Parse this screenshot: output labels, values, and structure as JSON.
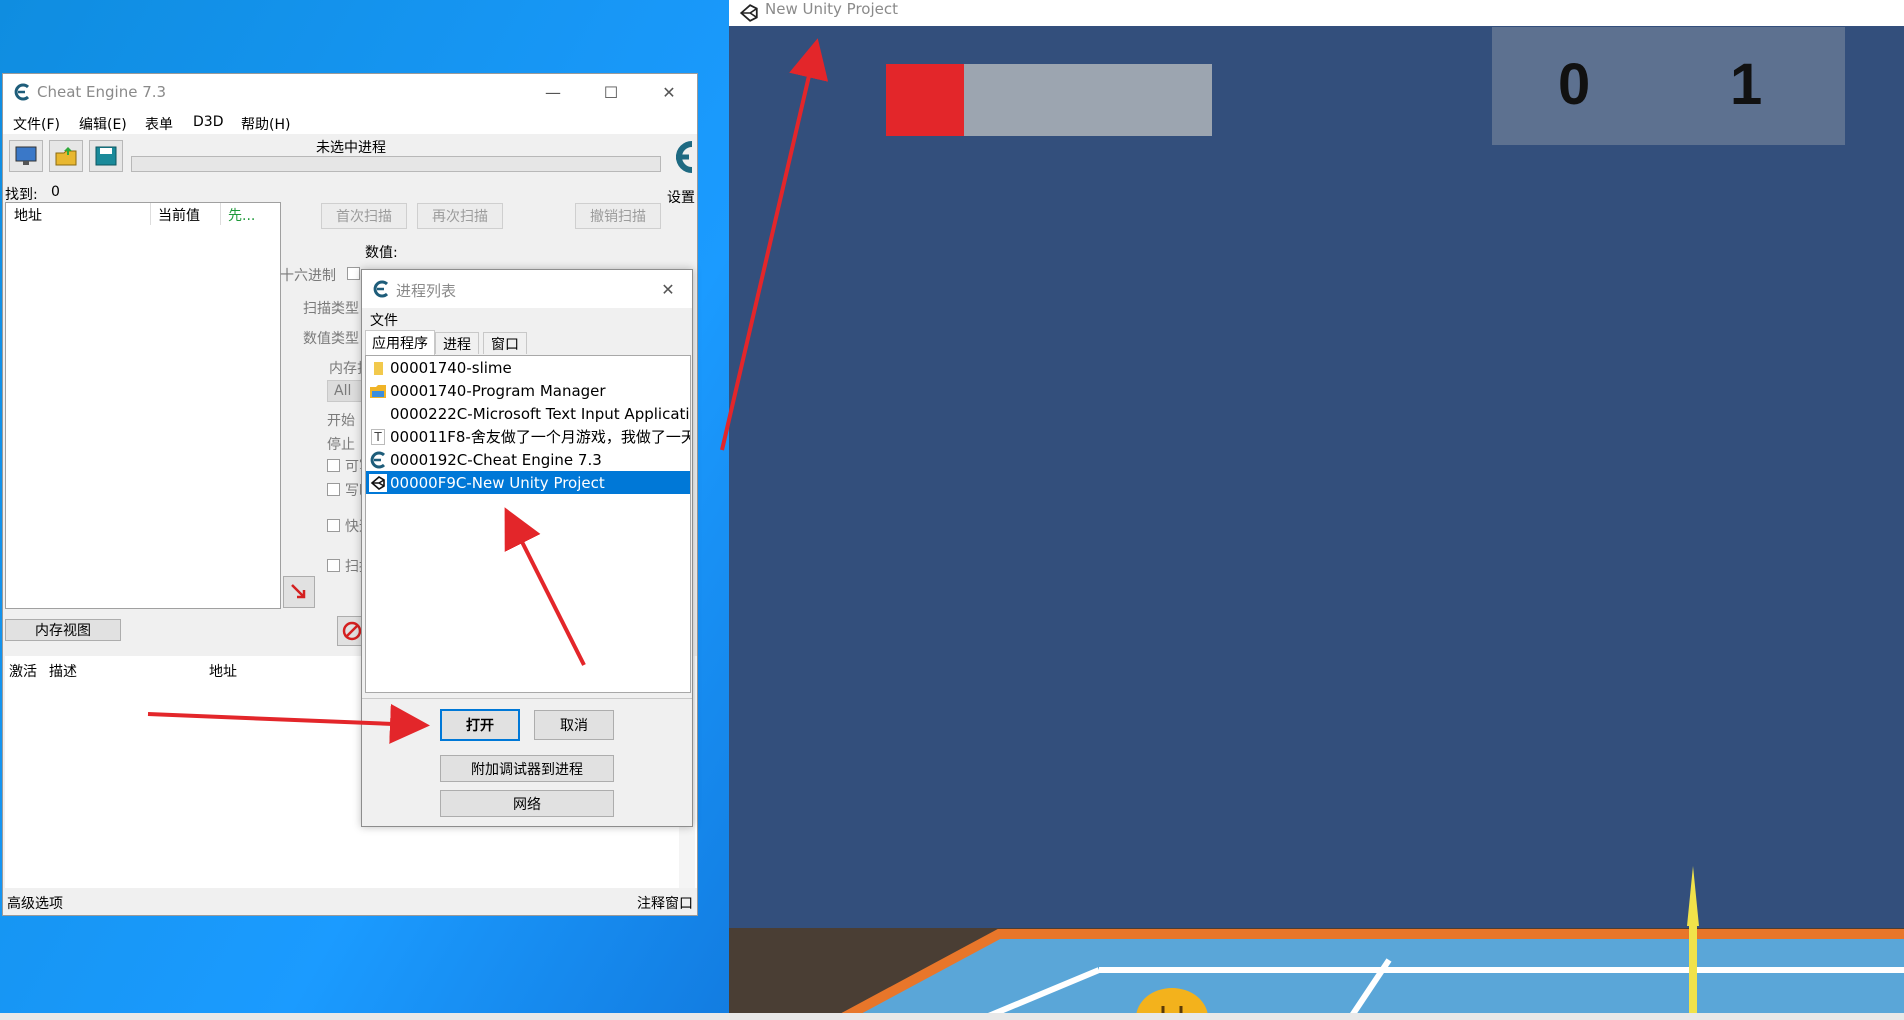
{
  "cheat_engine": {
    "title": "Cheat Engine 7.3",
    "menu": [
      "文件(F)",
      "编辑(E)",
      "表单",
      "D3D",
      "帮助(H)"
    ],
    "process_label": "未选中进程",
    "settings_label": "设置",
    "found_label": "找到:",
    "found_count": "0",
    "list_headers": {
      "address": "地址",
      "current_value": "当前值",
      "previous": "先..."
    },
    "buttons": {
      "first_scan": "首次扫描",
      "next_scan": "再次扫描",
      "undo_scan": "撤销扫描",
      "memory_view": "内存视图"
    },
    "labels": {
      "value": "数值:",
      "hex": "十六进制",
      "scan_type": "扫描类型",
      "value_type": "数值类型",
      "memory_options": "内存扫",
      "all": "All",
      "start": "开始",
      "stop": "停止",
      "writable": "可写",
      "copy_on_write": "写时",
      "fast_scan": "快速",
      "pause": "扫描"
    },
    "table_headers": {
      "active": "激活",
      "description": "描述",
      "address": "地址"
    },
    "bottom": {
      "advanced": "高级选项",
      "comments": "注释窗口"
    }
  },
  "process_dialog": {
    "title": "进程列表",
    "menu_file": "文件",
    "tabs": [
      "应用程序",
      "进程",
      "窗口"
    ],
    "processes": [
      {
        "label": "00001740-slime",
        "icon": "folder-icon"
      },
      {
        "label": "00001740-Program Manager",
        "icon": "explorer-icon"
      },
      {
        "label": "0000222C-Microsoft Text Input Applicati",
        "icon": ""
      },
      {
        "label": "000011F8-舍友做了一个月游戏，我做了一天",
        "icon": "text-icon"
      },
      {
        "label": "0000192C-Cheat Engine 7.3",
        "icon": "cheat-engine-icon"
      },
      {
        "label": "00000F9C-New Unity Project",
        "icon": "unity-icon",
        "selected": true
      }
    ],
    "buttons": {
      "open": "打开",
      "cancel": "取消",
      "attach_debugger": "附加调试器到进程",
      "network": "网络"
    }
  },
  "unity_window": {
    "title": "New Unity Project",
    "health_fraction": 0.24,
    "score_left": "0",
    "score_right": "1"
  },
  "colors": {
    "accent_arrow": "#e3262a",
    "selection": "#0078d7",
    "game_bg": "#334f7c"
  }
}
